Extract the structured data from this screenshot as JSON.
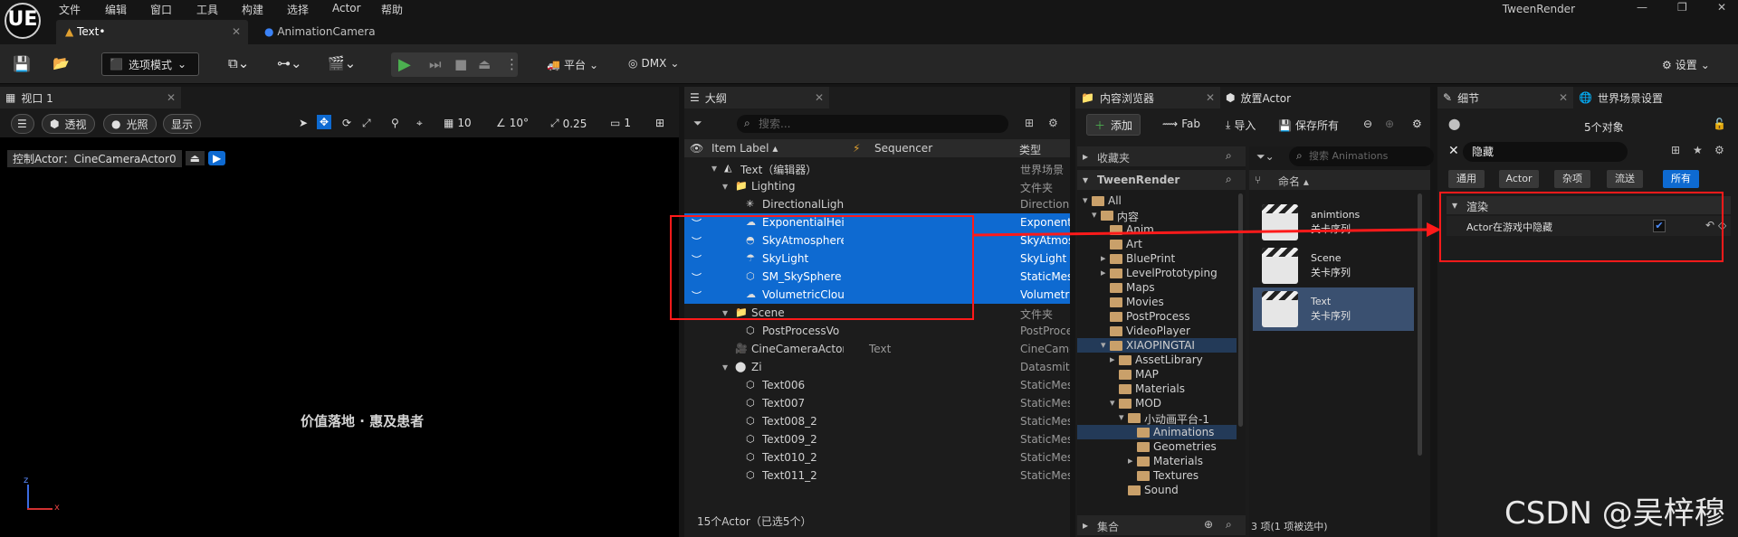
{
  "app": {
    "title": "TweenRender",
    "logo": "UE"
  },
  "menu": [
    "文件",
    "编辑",
    "窗口",
    "工具",
    "构建",
    "选择",
    "Actor",
    "帮助"
  ],
  "tabs": [
    {
      "label": "Text•",
      "active": true
    },
    {
      "label": "AnimationCamera",
      "active": false
    }
  ],
  "toolbar": {
    "mode": "选项模式",
    "platform": "平台",
    "dmx": "DMX",
    "settings": "设置"
  },
  "viewport": {
    "tab": "视口 1",
    "view_mode": "透视",
    "lighting": "光照",
    "show": "显示",
    "grid": "10",
    "angle": "10°",
    "scale": "0.25",
    "cam_speed": "1",
    "pilot": "控制Actor：CineCameraActor0",
    "caption": "价值落地 · 惠及患者",
    "axis_z": "z",
    "axis_x": "x"
  },
  "outliner": {
    "tab": "大纲",
    "search_placeholder": "搜索...",
    "columns": [
      "Item Label ▴",
      "Sequencer",
      "类型"
    ],
    "rows": [
      {
        "label": "Text（编辑器）",
        "type": "世界场景",
        "indent": 2,
        "icon": "map-icon",
        "expander": "▾",
        "selected": false,
        "seq": ""
      },
      {
        "label": "Lighting",
        "type": "文件夹",
        "indent": 3,
        "icon": "folder-icon",
        "expander": "▾",
        "selected": false,
        "seq": ""
      },
      {
        "label": "DirectionalLight",
        "type": "Directiona",
        "indent": 4,
        "icon": "light-icon",
        "expander": "",
        "selected": false,
        "seq": ""
      },
      {
        "label": "ExponentialHeig",
        "type": "Exponenti",
        "indent": 4,
        "icon": "fog-icon",
        "expander": "",
        "selected": true,
        "seq": ""
      },
      {
        "label": "SkyAtmosphere",
        "type": "SkyAtmos",
        "indent": 4,
        "icon": "sky-icon",
        "expander": "",
        "selected": true,
        "seq": ""
      },
      {
        "label": "SkyLight",
        "type": "SkyLight",
        "indent": 4,
        "icon": "skylight-icon",
        "expander": "",
        "selected": true,
        "seq": ""
      },
      {
        "label": "SM_SkySphere",
        "type": "StaticMes",
        "indent": 4,
        "icon": "mesh-icon",
        "expander": "",
        "selected": true,
        "seq": ""
      },
      {
        "label": "VolumetricClouc",
        "type": "Volumetri",
        "indent": 4,
        "icon": "cloud-icon",
        "expander": "",
        "selected": true,
        "seq": ""
      },
      {
        "label": "Scene",
        "type": "文件夹",
        "indent": 3,
        "icon": "folder-icon",
        "expander": "▾",
        "selected": false,
        "seq": ""
      },
      {
        "label": "PostProcessVo",
        "type": "PostProce",
        "indent": 4,
        "icon": "mesh-icon",
        "expander": "",
        "selected": false,
        "seq": ""
      },
      {
        "label": "CineCameraActor",
        "type": "CineCame",
        "indent": 3,
        "icon": "camera-icon",
        "expander": "",
        "selected": false,
        "seq": "Text"
      },
      {
        "label": "Zi",
        "type": "Datasmith",
        "indent": 3,
        "icon": "actor-icon",
        "expander": "▾",
        "selected": false,
        "seq": ""
      },
      {
        "label": "Text006",
        "type": "StaticMes",
        "indent": 4,
        "icon": "mesh-icon",
        "expander": "",
        "selected": false,
        "seq": ""
      },
      {
        "label": "Text007",
        "type": "StaticMes",
        "indent": 4,
        "icon": "mesh-icon",
        "expander": "",
        "selected": false,
        "seq": ""
      },
      {
        "label": "Text008_2",
        "type": "StaticMes",
        "indent": 4,
        "icon": "mesh-icon",
        "expander": "",
        "selected": false,
        "seq": ""
      },
      {
        "label": "Text009_2",
        "type": "StaticMes",
        "indent": 4,
        "icon": "mesh-icon",
        "expander": "",
        "selected": false,
        "seq": ""
      },
      {
        "label": "Text010_2",
        "type": "StaticMes",
        "indent": 4,
        "icon": "mesh-icon",
        "expander": "",
        "selected": false,
        "seq": ""
      },
      {
        "label": "Text011_2",
        "type": "StaticMes",
        "indent": 4,
        "icon": "mesh-icon",
        "expander": "",
        "selected": false,
        "seq": ""
      }
    ],
    "status": "15个Actor（已选5个）"
  },
  "content": {
    "tab": "内容浏览器",
    "tab2": "放置Actor",
    "add": "添加",
    "fab": "Fab",
    "import": "导入",
    "save_all": "保存所有",
    "favorites": "收藏夹",
    "project": "TweenRender",
    "search_placeholder": "搜索 Animations",
    "name_header": "命名 ▴",
    "tree": [
      {
        "label": "All",
        "level": 0,
        "exp": "▾"
      },
      {
        "label": "内容",
        "level": 1,
        "exp": "▾"
      },
      {
        "label": "Anim",
        "level": 2,
        "exp": ""
      },
      {
        "label": "Art",
        "level": 2,
        "exp": ""
      },
      {
        "label": "BluePrint",
        "level": 2,
        "exp": "▸"
      },
      {
        "label": "LevelPrototyping",
        "level": 2,
        "exp": "▸"
      },
      {
        "label": "Maps",
        "level": 2,
        "exp": ""
      },
      {
        "label": "Movies",
        "level": 2,
        "exp": ""
      },
      {
        "label": "PostProcess",
        "level": 2,
        "exp": ""
      },
      {
        "label": "VideoPlayer",
        "level": 2,
        "exp": ""
      },
      {
        "label": "XIAOPINGTAI",
        "level": 2,
        "exp": "▾",
        "hl": true
      },
      {
        "label": "AssetLibrary",
        "level": 3,
        "exp": "▸"
      },
      {
        "label": "MAP",
        "level": 3,
        "exp": ""
      },
      {
        "label": "Materials",
        "level": 3,
        "exp": ""
      },
      {
        "label": "MOD",
        "level": 3,
        "exp": "▾"
      },
      {
        "label": "小动画平台-1",
        "level": 4,
        "exp": "▾"
      },
      {
        "label": "Animations",
        "level": 5,
        "exp": "",
        "hl": true
      },
      {
        "label": "Geometries",
        "level": 5,
        "exp": ""
      },
      {
        "label": "Materials",
        "level": 5,
        "exp": "▸"
      },
      {
        "label": "Textures",
        "level": 5,
        "exp": ""
      },
      {
        "label": "Sound",
        "level": 4,
        "exp": ""
      }
    ],
    "assets": [
      {
        "name": "animtions",
        "type": "关卡序列",
        "selected": false
      },
      {
        "name": "Scene",
        "type": "关卡序列",
        "selected": false
      },
      {
        "name": "Text",
        "type": "关卡序列",
        "selected": true
      }
    ],
    "collections": "集合",
    "status": "3 项(1 项被选中)"
  },
  "details": {
    "tab": "细节",
    "tab2": "世界场景设置",
    "count": "5个对象",
    "search_value": "隐藏",
    "categories": [
      "通用",
      "Actor",
      "杂项",
      "流送",
      "所有"
    ],
    "section": "渲染",
    "prop_label": "Actor在游戏中隐藏",
    "prop_checked": true
  },
  "watermark": "CSDN @吴梓穆",
  "colors": {
    "selection": "#0e6ad1",
    "annotation": "#ff1a1a",
    "accent": "#0e6ad1"
  }
}
